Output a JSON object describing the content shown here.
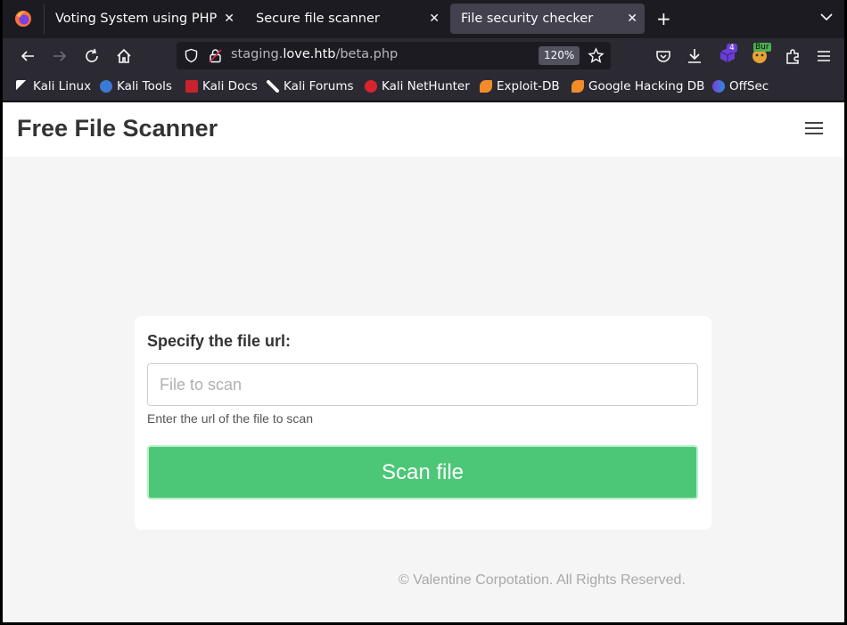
{
  "browser": {
    "tabs": [
      {
        "label": "Voting System using PHP",
        "active": false
      },
      {
        "label": "Secure file scanner",
        "active": false
      },
      {
        "label": "File security checker",
        "active": true
      }
    ],
    "url": {
      "prefix": "staging.",
      "host": "love.htb",
      "path": "/beta.php"
    },
    "zoom": "120%",
    "extension_badge": "4",
    "burp_badge": "Bur",
    "bookmarks": [
      {
        "label": "Kali Linux",
        "icon": "kali-dragon-icon"
      },
      {
        "label": "Kali Tools",
        "icon": "kali-tools-icon"
      },
      {
        "label": "Kali Docs",
        "icon": "kali-docs-icon"
      },
      {
        "label": "Kali Forums",
        "icon": "kali-forums-icon"
      },
      {
        "label": "Kali NetHunter",
        "icon": "nethunter-icon"
      },
      {
        "label": "Exploit-DB",
        "icon": "exploit-db-icon"
      },
      {
        "label": "Google Hacking DB",
        "icon": "ghdb-icon"
      },
      {
        "label": "OffSec",
        "icon": "offsec-icon"
      }
    ]
  },
  "page": {
    "brand": "Free File Scanner",
    "form": {
      "label": "Specify the file url:",
      "input_value": "",
      "input_placeholder": "File to scan",
      "help_text": "Enter the url of the file to scan",
      "button_label": "Scan file"
    },
    "footer": "© Valentine Corpotation. All Rights Reserved."
  },
  "colors": {
    "accent_button": "#4cc777",
    "tab_active": "#42414d",
    "toolbar": "#2b2a33"
  }
}
